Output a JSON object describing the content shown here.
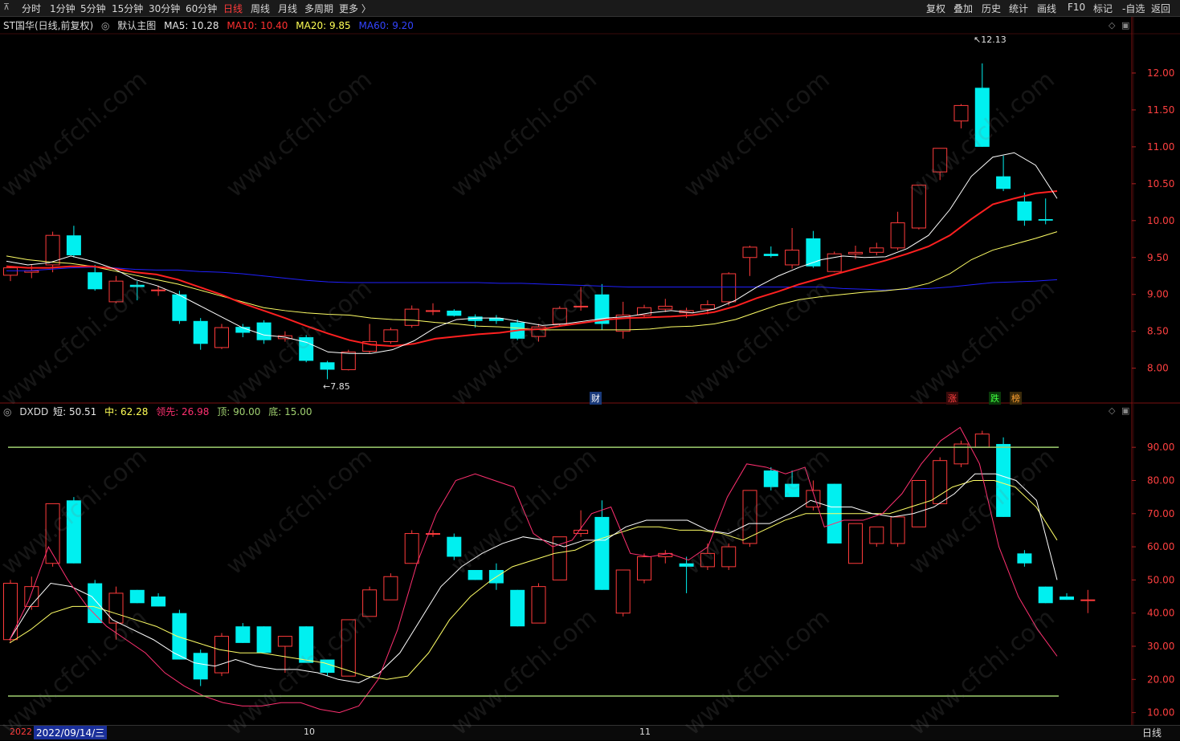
{
  "toolbar": {
    "left_items": [
      "分时",
      "1分钟",
      "5分钟",
      "15分钟",
      "30分钟",
      "60分钟",
      "日线",
      "周线",
      "月线",
      "多周期",
      "更多 〉"
    ],
    "active_item": "日线",
    "right_buttons": [
      "复权",
      "叠加",
      "历史",
      "统计",
      "画线",
      "F10",
      "标记",
      "-自选",
      "返回"
    ]
  },
  "main_legend": {
    "title": "ST国华(日线,前复权)",
    "template": "默认主图",
    "ma5": "MA5: 10.28",
    "ma10": "MA10: 10.40",
    "ma20": "MA20: 9.85",
    "ma60": "MA60: 9.20"
  },
  "sub_legend": {
    "name": "DXDD",
    "short": "短: 50.51",
    "mid": "中: 62.28",
    "lead": "领先: 26.98",
    "top": "顶: 90.00",
    "bottom": "底: 15.00"
  },
  "annotations": {
    "high_label": "12.13",
    "low_label": "7.85",
    "tag_cai": "财",
    "tag_zhang": "涨",
    "tag_die": "跌",
    "tag_bang": "榜"
  },
  "bottom_bar": {
    "date_left": "2022",
    "cursor_date": "2022/09/14/三",
    "month_10": "10",
    "month_11": "11",
    "period_tab": "日线"
  },
  "watermark": "www.cfchi.com",
  "colors": {
    "up": "#ff3b3b",
    "down": "#00f0f0",
    "ma5": "#ffffff",
    "ma10": "#ff2020",
    "ma20": "#ffff66",
    "ma60": "#2020ff",
    "lead": "#ff3070",
    "level": "#a0d070"
  },
  "chart_data": [
    {
      "type": "candlestick",
      "title": "ST国华(日线,前复权)",
      "y_ticks": [
        12.0,
        11.5,
        11.0,
        10.5,
        10.0,
        9.5,
        9.0,
        8.5,
        8.0
      ],
      "ylim": [
        7.55,
        12.5
      ],
      "candles": [
        {
          "o": 9.26,
          "h": 9.38,
          "l": 9.18,
          "c": 9.36
        },
        {
          "o": 9.3,
          "h": 9.4,
          "l": 9.22,
          "c": 9.32
        },
        {
          "o": 9.4,
          "h": 9.85,
          "l": 9.3,
          "c": 9.8
        },
        {
          "o": 9.8,
          "h": 9.93,
          "l": 9.5,
          "c": 9.53
        },
        {
          "o": 9.3,
          "h": 9.4,
          "l": 9.05,
          "c": 9.07
        },
        {
          "o": 8.9,
          "h": 9.25,
          "l": 8.88,
          "c": 9.18
        },
        {
          "o": 9.13,
          "h": 9.18,
          "l": 8.92,
          "c": 9.1
        },
        {
          "o": 9.06,
          "h": 9.12,
          "l": 8.98,
          "c": 9.06
        },
        {
          "o": 9.0,
          "h": 9.05,
          "l": 8.6,
          "c": 8.64
        },
        {
          "o": 8.64,
          "h": 8.68,
          "l": 8.25,
          "c": 8.33
        },
        {
          "o": 8.28,
          "h": 8.6,
          "l": 8.26,
          "c": 8.55
        },
        {
          "o": 8.56,
          "h": 8.6,
          "l": 8.42,
          "c": 8.48
        },
        {
          "o": 8.62,
          "h": 8.65,
          "l": 8.33,
          "c": 8.38
        },
        {
          "o": 8.4,
          "h": 8.5,
          "l": 8.36,
          "c": 8.44
        },
        {
          "o": 8.42,
          "h": 8.45,
          "l": 8.08,
          "c": 8.1
        },
        {
          "o": 8.08,
          "h": 8.1,
          "l": 7.85,
          "c": 7.98
        },
        {
          "o": 7.98,
          "h": 8.25,
          "l": 7.97,
          "c": 8.22
        },
        {
          "o": 8.23,
          "h": 8.6,
          "l": 8.2,
          "c": 8.36
        },
        {
          "o": 8.36,
          "h": 8.55,
          "l": 8.33,
          "c": 8.52
        },
        {
          "o": 8.58,
          "h": 8.85,
          "l": 8.55,
          "c": 8.8
        },
        {
          "o": 8.78,
          "h": 8.88,
          "l": 8.72,
          "c": 8.78
        },
        {
          "o": 8.78,
          "h": 8.8,
          "l": 8.7,
          "c": 8.71
        },
        {
          "o": 8.7,
          "h": 8.73,
          "l": 8.55,
          "c": 8.64
        },
        {
          "o": 8.68,
          "h": 8.72,
          "l": 8.6,
          "c": 8.64
        },
        {
          "o": 8.62,
          "h": 8.66,
          "l": 8.38,
          "c": 8.4
        },
        {
          "o": 8.43,
          "h": 8.6,
          "l": 8.36,
          "c": 8.56
        },
        {
          "o": 8.6,
          "h": 8.84,
          "l": 8.57,
          "c": 8.81
        },
        {
          "o": 8.84,
          "h": 9.1,
          "l": 8.78,
          "c": 8.84
        },
        {
          "o": 9.0,
          "h": 9.14,
          "l": 8.52,
          "c": 8.6
        },
        {
          "o": 8.5,
          "h": 8.9,
          "l": 8.4,
          "c": 8.72
        },
        {
          "o": 8.72,
          "h": 8.86,
          "l": 8.68,
          "c": 8.82
        },
        {
          "o": 8.8,
          "h": 8.94,
          "l": 8.76,
          "c": 8.84
        },
        {
          "o": 8.75,
          "h": 8.82,
          "l": 8.68,
          "c": 8.78
        },
        {
          "o": 8.8,
          "h": 8.92,
          "l": 8.73,
          "c": 8.86
        },
        {
          "o": 8.9,
          "h": 9.3,
          "l": 8.85,
          "c": 9.28
        },
        {
          "o": 9.5,
          "h": 9.66,
          "l": 9.25,
          "c": 9.64
        },
        {
          "o": 9.55,
          "h": 9.65,
          "l": 9.5,
          "c": 9.52
        },
        {
          "o": 9.4,
          "h": 9.9,
          "l": 9.35,
          "c": 9.6
        },
        {
          "o": 9.76,
          "h": 9.86,
          "l": 9.36,
          "c": 9.38
        },
        {
          "o": 9.31,
          "h": 9.58,
          "l": 9.3,
          "c": 9.55
        },
        {
          "o": 9.55,
          "h": 9.66,
          "l": 9.48,
          "c": 9.57
        },
        {
          "o": 9.57,
          "h": 9.7,
          "l": 9.53,
          "c": 9.63
        },
        {
          "o": 9.63,
          "h": 10.12,
          "l": 9.6,
          "c": 9.97
        },
        {
          "o": 9.9,
          "h": 10.48,
          "l": 9.88,
          "c": 10.48
        },
        {
          "o": 10.66,
          "h": 10.98,
          "l": 10.55,
          "c": 10.98
        },
        {
          "o": 11.35,
          "h": 11.58,
          "l": 11.25,
          "c": 11.56
        },
        {
          "o": 11.8,
          "h": 12.13,
          "l": 11.0,
          "c": 11.0
        },
        {
          "o": 10.6,
          "h": 10.88,
          "l": 10.4,
          "c": 10.43
        },
        {
          "o": 10.26,
          "h": 10.38,
          "l": 9.93,
          "c": 10.0
        },
        {
          "o": 10.02,
          "h": 10.3,
          "l": 9.95,
          "c": 10.0
        }
      ],
      "ma5": [
        9.45,
        9.4,
        9.43,
        9.52,
        9.45,
        9.35,
        9.2,
        9.12,
        9.0,
        8.85,
        8.7,
        8.55,
        8.45,
        8.42,
        8.35,
        8.22,
        8.2,
        8.2,
        8.25,
        8.37,
        8.55,
        8.66,
        8.68,
        8.68,
        8.63,
        8.58,
        8.6,
        8.64,
        8.68,
        8.7,
        8.75,
        8.78,
        8.75,
        8.8,
        8.92,
        9.1,
        9.25,
        9.37,
        9.47,
        9.52,
        9.5,
        9.51,
        9.62,
        9.8,
        10.15,
        10.6,
        10.86,
        10.92,
        10.75,
        10.3
      ],
      "ma10": [
        9.38,
        9.36,
        9.36,
        9.38,
        9.38,
        9.35,
        9.3,
        9.27,
        9.2,
        9.1,
        9.0,
        8.88,
        8.78,
        8.68,
        8.57,
        8.47,
        8.38,
        8.32,
        8.3,
        8.33,
        8.4,
        8.43,
        8.46,
        8.48,
        8.52,
        8.53,
        8.58,
        8.62,
        8.66,
        8.68,
        8.69,
        8.7,
        8.72,
        8.76,
        8.84,
        8.95,
        9.04,
        9.14,
        9.22,
        9.3,
        9.38,
        9.46,
        9.55,
        9.65,
        9.8,
        10.02,
        10.22,
        10.3,
        10.37,
        10.4
      ],
      "ma20": [
        9.52,
        9.47,
        9.44,
        9.42,
        9.38,
        9.32,
        9.26,
        9.2,
        9.14,
        9.06,
        8.98,
        8.9,
        8.82,
        8.78,
        8.75,
        8.73,
        8.72,
        8.68,
        8.66,
        8.65,
        8.62,
        8.6,
        8.57,
        8.56,
        8.54,
        8.52,
        8.52,
        8.52,
        8.52,
        8.52,
        8.53,
        8.56,
        8.57,
        8.6,
        8.66,
        8.76,
        8.86,
        8.93,
        8.97,
        9.0,
        9.03,
        9.05,
        9.08,
        9.15,
        9.28,
        9.47,
        9.6,
        9.68,
        9.76,
        9.85
      ],
      "ma60": [
        9.32,
        9.32,
        9.34,
        9.36,
        9.37,
        9.36,
        9.34,
        9.33,
        9.33,
        9.31,
        9.3,
        9.28,
        9.25,
        9.22,
        9.19,
        9.17,
        9.16,
        9.16,
        9.16,
        9.16,
        9.16,
        9.16,
        9.16,
        9.15,
        9.15,
        9.14,
        9.13,
        9.12,
        9.11,
        9.1,
        9.1,
        9.1,
        9.1,
        9.1,
        9.1,
        9.1,
        9.1,
        9.1,
        9.1,
        9.08,
        9.07,
        9.06,
        9.07,
        9.08,
        9.1,
        9.13,
        9.16,
        9.17,
        9.18,
        9.2
      ]
    },
    {
      "type": "candlestick",
      "title": "DXDD",
      "y_ticks": [
        90.0,
        80.0,
        70.0,
        60.0,
        50.0,
        40.0,
        30.0,
        20.0,
        10.0
      ],
      "ylim": [
        7,
        99
      ],
      "top_level": 90.0,
      "bottom_level": 15.0,
      "candles": [
        {
          "o": 32,
          "h": 50,
          "l": 31,
          "c": 49
        },
        {
          "o": 42,
          "h": 51,
          "l": 41,
          "c": 48
        },
        {
          "o": 55,
          "h": 73,
          "l": 54,
          "c": 73
        },
        {
          "o": 74,
          "h": 75,
          "l": 55,
          "c": 55
        },
        {
          "o": 49,
          "h": 50,
          "l": 37,
          "c": 37
        },
        {
          "o": 37,
          "h": 48,
          "l": 32,
          "c": 46
        },
        {
          "o": 47,
          "h": 47,
          "l": 43,
          "c": 43
        },
        {
          "o": 45,
          "h": 46,
          "l": 42,
          "c": 42
        },
        {
          "o": 40,
          "h": 41,
          "l": 26,
          "c": 26
        },
        {
          "o": 28,
          "h": 29,
          "l": 18,
          "c": 20
        },
        {
          "o": 22,
          "h": 34,
          "l": 21,
          "c": 33
        },
        {
          "o": 36,
          "h": 37,
          "l": 31,
          "c": 31
        },
        {
          "o": 36,
          "h": 36,
          "l": 28,
          "c": 28
        },
        {
          "o": 30,
          "h": 33,
          "l": 22,
          "c": 33
        },
        {
          "o": 36,
          "h": 36,
          "l": 25,
          "c": 25
        },
        {
          "o": 26,
          "h": 26,
          "l": 21,
          "c": 22
        },
        {
          "o": 21,
          "h": 38,
          "l": 21,
          "c": 38
        },
        {
          "o": 39,
          "h": 48,
          "l": 39,
          "c": 47
        },
        {
          "o": 44,
          "h": 52,
          "l": 44,
          "c": 51
        },
        {
          "o": 55,
          "h": 65,
          "l": 55,
          "c": 64
        },
        {
          "o": 64,
          "h": 65,
          "l": 63,
          "c": 64
        },
        {
          "o": 63,
          "h": 64,
          "l": 56,
          "c": 57
        },
        {
          "o": 53,
          "h": 53,
          "l": 50,
          "c": 50
        },
        {
          "o": 53,
          "h": 55,
          "l": 47,
          "c": 49
        },
        {
          "o": 47,
          "h": 47,
          "l": 36,
          "c": 36
        },
        {
          "o": 37,
          "h": 49,
          "l": 37,
          "c": 48
        },
        {
          "o": 50,
          "h": 63,
          "l": 50,
          "c": 63
        },
        {
          "o": 64,
          "h": 71,
          "l": 63,
          "c": 65
        },
        {
          "o": 69,
          "h": 74,
          "l": 47,
          "c": 47
        },
        {
          "o": 40,
          "h": 53,
          "l": 39,
          "c": 53
        },
        {
          "o": 50,
          "h": 58,
          "l": 49,
          "c": 57
        },
        {
          "o": 57,
          "h": 59,
          "l": 55,
          "c": 58
        },
        {
          "o": 55,
          "h": 57,
          "l": 46,
          "c": 54
        },
        {
          "o": 54,
          "h": 61,
          "l": 53,
          "c": 58
        },
        {
          "o": 54,
          "h": 61,
          "l": 53,
          "c": 60
        },
        {
          "o": 61,
          "h": 77,
          "l": 60,
          "c": 77
        },
        {
          "o": 83,
          "h": 84,
          "l": 77,
          "c": 78
        },
        {
          "o": 79,
          "h": 83,
          "l": 75,
          "c": 75
        },
        {
          "o": 72,
          "h": 80,
          "l": 71,
          "c": 77
        },
        {
          "o": 79,
          "h": 79,
          "l": 61,
          "c": 61
        },
        {
          "o": 55,
          "h": 67,
          "l": 55,
          "c": 67
        },
        {
          "o": 61,
          "h": 66,
          "l": 60,
          "c": 66
        },
        {
          "o": 61,
          "h": 69,
          "l": 60,
          "c": 69
        },
        {
          "o": 66,
          "h": 80,
          "l": 66,
          "c": 80
        },
        {
          "o": 73,
          "h": 87,
          "l": 73,
          "c": 86
        },
        {
          "o": 85,
          "h": 92,
          "l": 84,
          "c": 91
        },
        {
          "o": 90,
          "h": 95,
          "l": 90,
          "c": 94
        },
        {
          "o": 91,
          "h": 93,
          "l": 69,
          "c": 69
        },
        {
          "o": 58,
          "h": 59,
          "l": 54,
          "c": 55
        },
        {
          "o": 48,
          "h": 48,
          "l": 43,
          "c": 43
        },
        {
          "o": 45,
          "h": 46,
          "l": 44,
          "c": 44
        },
        {
          "o": 44,
          "h": 47,
          "l": 40,
          "c": 44
        }
      ],
      "short": [
        32,
        42,
        49,
        48,
        45,
        38,
        35,
        32,
        28,
        25,
        24,
        26,
        24,
        23,
        23,
        22,
        20,
        19,
        22,
        28,
        38,
        48,
        54,
        58,
        61,
        63,
        62,
        60,
        62,
        62,
        66,
        68,
        68,
        68,
        65,
        64,
        67,
        67,
        70,
        74,
        72,
        72,
        70,
        69,
        70,
        72,
        76,
        82,
        82,
        80,
        74,
        50
      ],
      "mid": [
        31,
        35,
        40,
        42,
        42,
        40,
        38,
        36,
        33,
        31,
        29,
        28,
        28,
        27,
        26,
        25,
        23,
        21,
        20,
        21,
        28,
        38,
        45,
        50,
        54,
        56,
        58,
        59,
        62,
        64,
        66,
        66,
        65,
        65,
        64,
        62,
        65,
        68,
        70,
        70,
        70,
        70,
        70,
        72,
        74,
        78,
        80,
        80,
        78,
        72,
        62
      ],
      "lead": [
        32,
        44,
        60,
        50,
        42,
        36,
        32,
        28,
        22,
        18,
        15,
        13,
        12,
        12,
        13,
        13,
        11,
        10,
        12,
        20,
        35,
        55,
        70,
        80,
        82,
        80,
        78,
        64,
        60,
        62,
        70,
        72,
        58,
        57,
        58,
        56,
        60,
        75,
        85,
        84,
        82,
        84,
        66,
        68,
        68,
        70,
        76,
        85,
        92,
        96,
        85,
        60,
        45,
        35,
        27
      ]
    }
  ]
}
